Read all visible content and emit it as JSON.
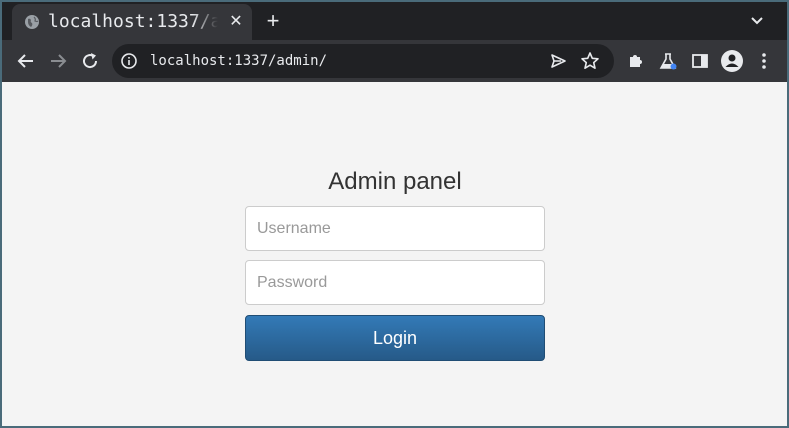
{
  "browser": {
    "tab": {
      "title": "localhost:1337/admin/",
      "favicon": "globe-icon",
      "close_icon": "close-icon"
    },
    "new_tab_icon": "plus-icon",
    "tab_search_icon": "chevron-down-icon",
    "toolbar": {
      "back_icon": "back-arrow-icon",
      "forward_icon": "forward-arrow-icon",
      "reload_icon": "reload-icon",
      "site_info_icon": "info-icon",
      "url": "localhost:1337/admin/",
      "send_icon": "send-icon",
      "bookmark_icon": "star-icon",
      "extensions_icon": "puzzle-icon",
      "labs_icon": "flask-icon",
      "side_panel_icon": "side-panel-icon",
      "profile_icon": "profile-icon",
      "menu_icon": "kebab-menu-icon"
    }
  },
  "login_form": {
    "heading": "Admin panel",
    "username": {
      "value": "",
      "placeholder": "Username"
    },
    "password": {
      "value": "",
      "placeholder": "Password"
    },
    "submit_label": "Login"
  },
  "colors": {
    "tabstrip_bg": "#202124",
    "toolbar_bg": "#35363a",
    "page_bg": "#f4f4f4",
    "button_primary": "#337ab7",
    "button_primary_dark": "#265a88"
  }
}
